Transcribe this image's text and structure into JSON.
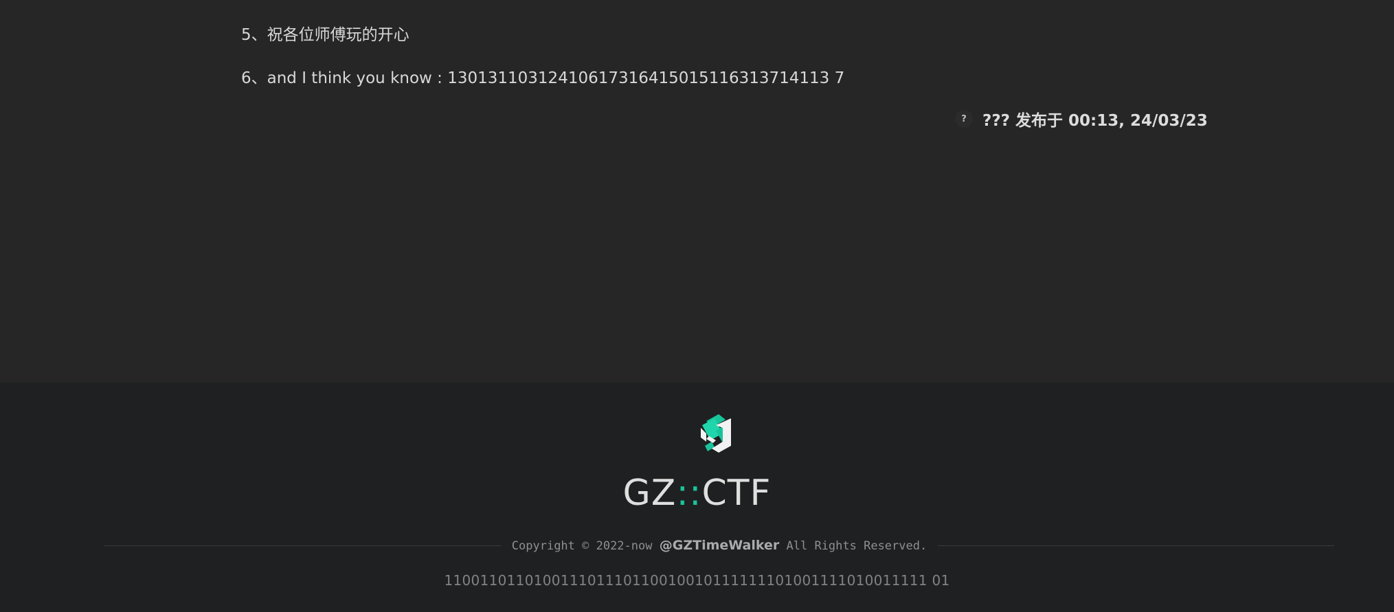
{
  "post": {
    "line5": "5、祝各位师傅玩的开心",
    "line6": "6、and I think you know : 13013110312410617316415015116313714113 7",
    "author_avatar": "?",
    "author_meta": "??? 发布于 00:13, 24/03/23"
  },
  "footer": {
    "logo_icon": "gzctf-logo-icon",
    "brand_left": "GZ",
    "brand_sep": "::",
    "brand_right": "CTF",
    "copyright_prefix": "Copyright © 2022-now",
    "copyright_handle": "@GZTimeWalker",
    "copyright_suffix": "All Rights Reserved.",
    "binary": "110011011010011101110110010010111111101001111010011111 01"
  },
  "colors": {
    "accent": "#19c39b",
    "content_bg": "#262626",
    "footer_bg": "#1f2021"
  }
}
